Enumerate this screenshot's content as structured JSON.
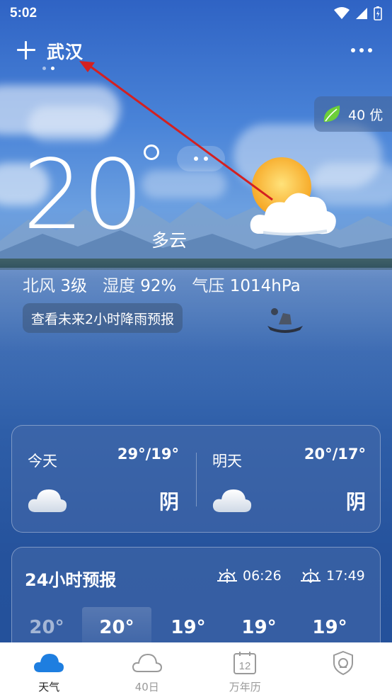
{
  "status": {
    "time": "5:02"
  },
  "header": {
    "city": "武汉"
  },
  "aqi": {
    "value": "40",
    "label": "优",
    "text": "40 优"
  },
  "current": {
    "temperature": "20",
    "condition": "多云",
    "wind_label": "北风",
    "wind_value": "3级",
    "humidity_label": "湿度",
    "humidity_value": "92%",
    "pressure_label": "气压",
    "pressure_value": "1014hPa",
    "rain_forecast_button": "查看未来2小时降雨预报"
  },
  "days": [
    {
      "name": "今天",
      "range": "29°/19°",
      "condition": "阴"
    },
    {
      "name": "明天",
      "range": "20°/17°",
      "condition": "阴"
    }
  ],
  "hourly": {
    "title": "24小时预报",
    "sunrise": "06:26",
    "sunset": "17:49",
    "temps": [
      "20°",
      "20°",
      "19°",
      "19°",
      "19°"
    ]
  },
  "tabs": [
    {
      "label": "天气",
      "icon": "cloud-filled-icon"
    },
    {
      "label": "40日",
      "icon": "cloud-outline-icon"
    },
    {
      "label": "万年历",
      "icon": "calendar-icon",
      "icon_text": "12"
    },
    {
      "label": "",
      "icon": "shield-icon"
    }
  ],
  "colors": {
    "accent": "#1e7ee0",
    "annotation_arrow": "#d42020"
  }
}
